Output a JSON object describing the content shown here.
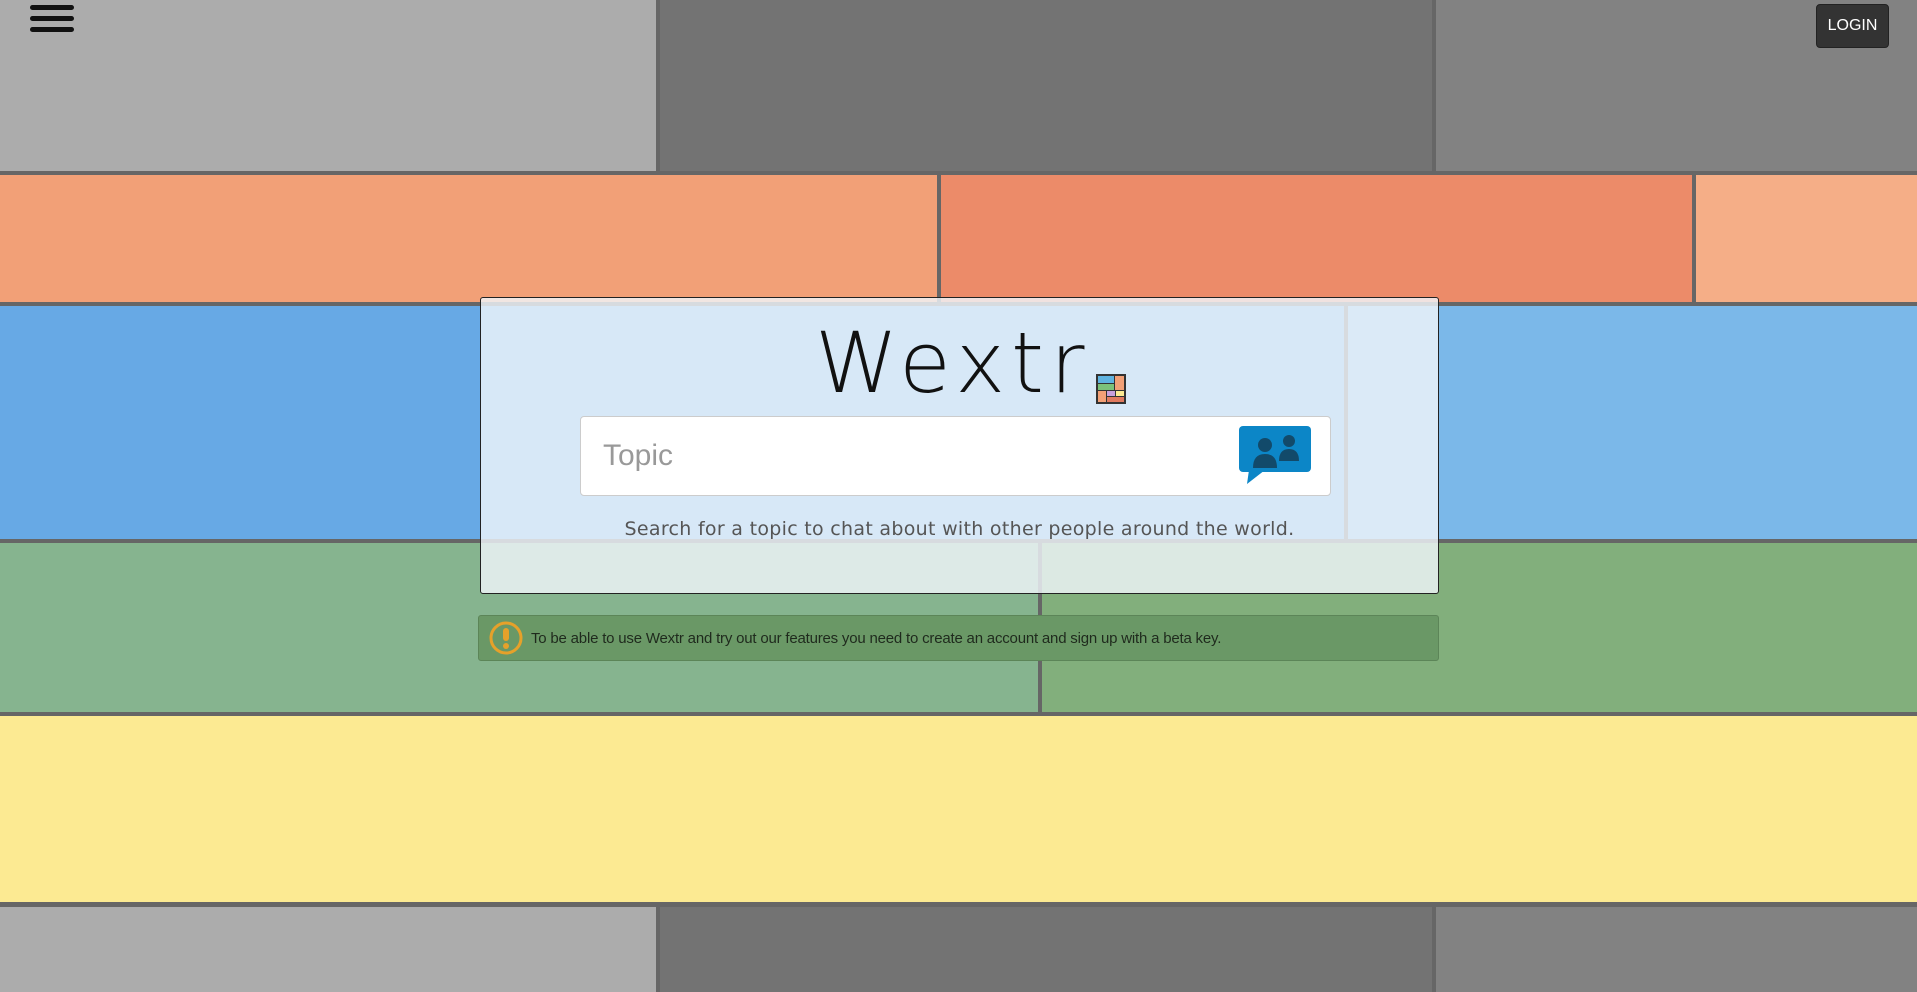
{
  "header": {
    "menu_icon": "hamburger-menu-icon",
    "login_label": "LOGIN"
  },
  "brand": {
    "name": "Wextr",
    "logo_icon": "tile-mosaic-icon"
  },
  "search": {
    "placeholder": "Topic",
    "value": "",
    "button_icon": "chat-people-icon",
    "helper_text": "Search for a topic to chat about with other people around the world."
  },
  "alert": {
    "icon": "exclamation-circle-icon",
    "text": "To be able to use Wextr and try out our features you need to create an account and sign up with a beta key."
  },
  "colors": {
    "gray_light": "#acacac",
    "gray_dark": "#737373",
    "gray_mid": "#828282",
    "orange": "#f2a077",
    "orange_dark": "#ec8b69",
    "orange_light": "#f5ae87",
    "blue": "#67a9e5",
    "blue_light": "#7bb8e9",
    "green": "#86b48f",
    "green_alt": "#82af7c",
    "yellow": "#fcea92",
    "chat_button": "#0c86c7",
    "alert_bg": "#6a9866",
    "alert_icon": "#e6a12a"
  }
}
